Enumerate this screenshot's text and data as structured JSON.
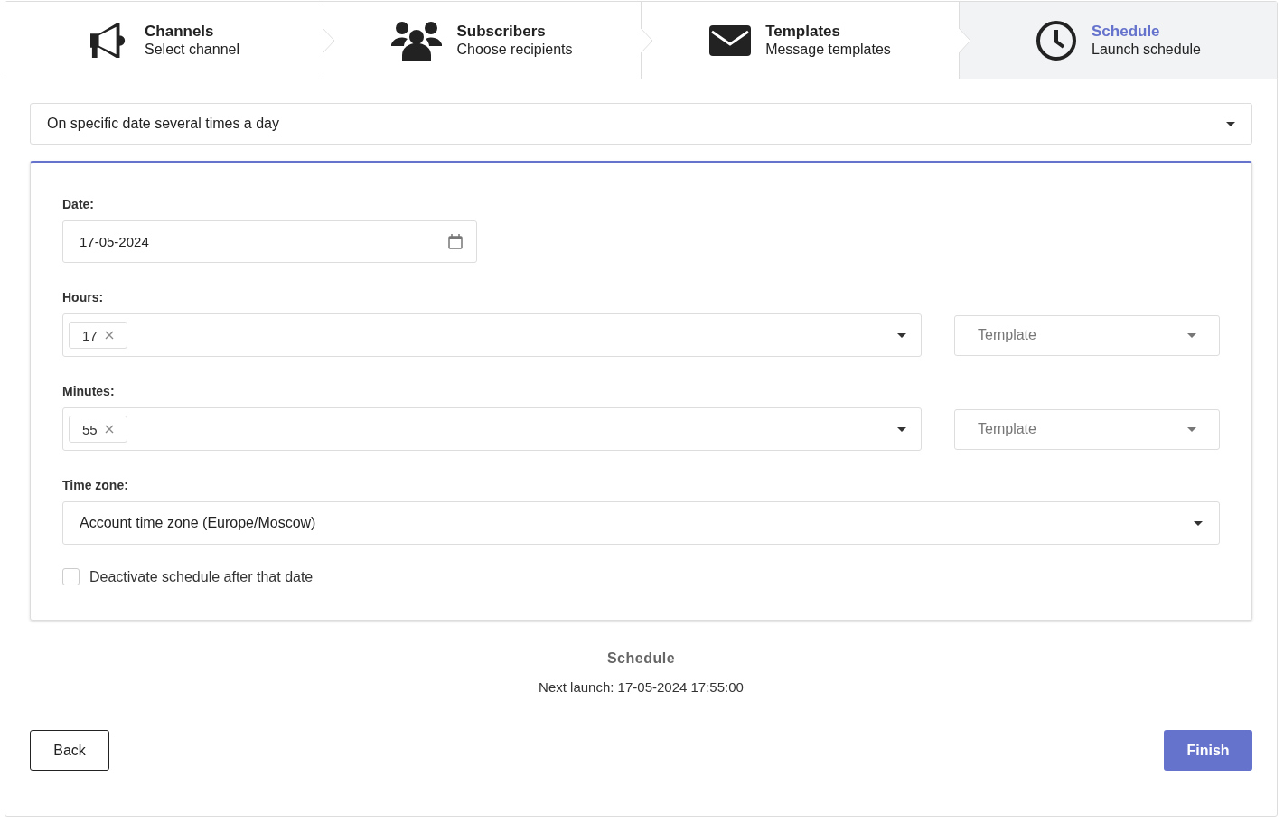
{
  "steps": [
    {
      "kind": "megaphone",
      "title": "Channels",
      "subtitle": "Select channel",
      "selected": false
    },
    {
      "kind": "users",
      "title": "Subscribers",
      "subtitle": "Choose recipients",
      "selected": false
    },
    {
      "kind": "envelope",
      "title": "Templates",
      "subtitle": "Message templates",
      "selected": false
    },
    {
      "kind": "clock",
      "title": "Schedule",
      "subtitle": "Launch schedule",
      "selected": true
    }
  ],
  "schedule_type": {
    "value": "On specific date several times a day"
  },
  "date": {
    "label": "Date:",
    "value": "17-05-2024"
  },
  "time_rows": [
    {
      "label": "Hours:",
      "tags": [
        "17"
      ],
      "template": {
        "placeholder": "Template"
      }
    },
    {
      "label": "Minutes:",
      "tags": [
        "55"
      ],
      "template": {
        "placeholder": "Template"
      }
    }
  ],
  "time_zone": {
    "label": "Time zone:",
    "value": "Account time zone (Europe/Moscow)"
  },
  "deactivate": {
    "label": "Deactivate schedule after that date",
    "checked": false
  },
  "summary": {
    "title": "Schedule",
    "next_launch": "Next launch: 17-05-2024 17:55:00"
  },
  "buttons": {
    "back": "Back",
    "finish": "Finish"
  }
}
